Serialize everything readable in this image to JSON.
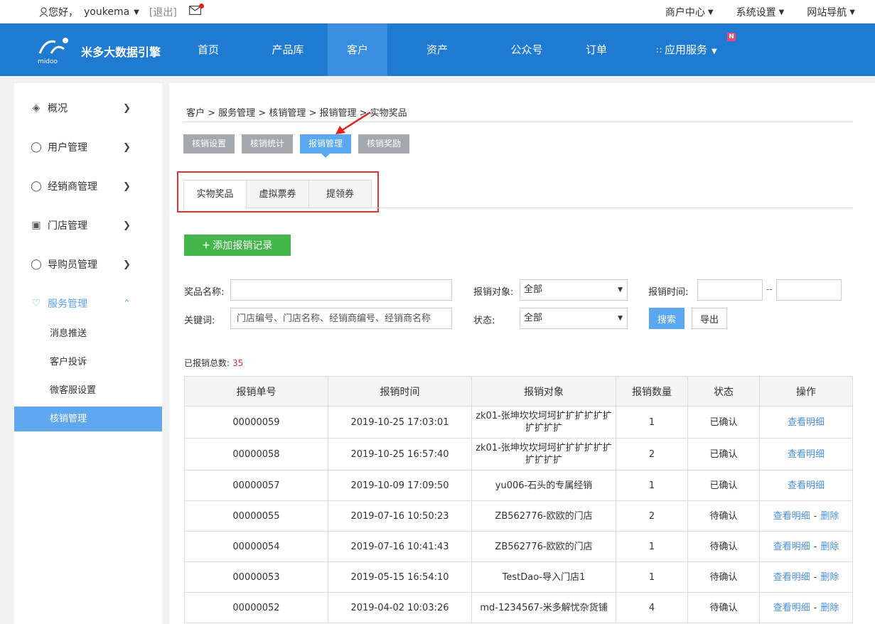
{
  "topbar": {
    "greeting": "您好，",
    "username": "youkema",
    "logout": "[退出]",
    "right_menu": [
      "商户中心",
      "系统设置",
      "网站导航"
    ]
  },
  "header": {
    "brand": "米多大数据引擎",
    "logo_text": "midoo",
    "nav": [
      "首页",
      "产品库",
      "客户",
      "资产",
      "公众号",
      "订单",
      "应用服务"
    ],
    "active_nav": "客户",
    "new_badge": "N"
  },
  "sidebar": {
    "items": [
      {
        "label": "概况",
        "icon": "layers-icon"
      },
      {
        "label": "用户管理",
        "icon": "user-icon"
      },
      {
        "label": "经销商管理",
        "icon": "users-icon"
      },
      {
        "label": "门店管理",
        "icon": "store-icon"
      },
      {
        "label": "导购员管理",
        "icon": "person-icon"
      },
      {
        "label": "服务管理",
        "icon": "heart-icon"
      }
    ],
    "sub_items": [
      "消息推送",
      "客户投诉",
      "微客服设置",
      "核销管理"
    ],
    "active_sub": "核销管理"
  },
  "content": {
    "breadcrumb": "客户 > 服务管理 > 核销管理 > 报销管理 > 实物奖品",
    "subtabs": [
      "核销设置",
      "核销统计",
      "报销管理",
      "核销奖励"
    ],
    "active_subtab": "报销管理",
    "tabs": [
      "实物奖品",
      "虚拟票券",
      "提领券"
    ],
    "active_tab": "实物奖品",
    "add_button": "添加报销记录",
    "filters": {
      "prize_name_label": "奖品名称:",
      "prize_name_value": "",
      "target_label": "报销对象:",
      "target_value": "全部",
      "time_label": "报销时间:",
      "time_from": "",
      "time_to": "",
      "time_separator": "--",
      "keyword_label": "关键词:",
      "keyword_placeholder": "门店编号、门店名称、经销商编号、经销商名称",
      "status_label": "状态:",
      "status_value": "全部",
      "search_button": "搜索",
      "export_button": "导出"
    },
    "total_label": "已报销总数:",
    "total_value": "35",
    "table": {
      "headers": [
        "报销单号",
        "报销时间",
        "报销对象",
        "报销数量",
        "状态",
        "操作"
      ],
      "rows": [
        {
          "id": "00000059",
          "time": "2019-10-25 17:03:01",
          "target": "zk01-张坤坎坎坷坷扩扩扩扩扩扩扩扩扩扩",
          "qty": "1",
          "status": "已确认",
          "view": "查看明细",
          "delete": ""
        },
        {
          "id": "00000058",
          "time": "2019-10-25 16:57:40",
          "target": "zk01-张坤坎坎坷坷扩扩扩扩扩扩扩扩扩扩",
          "qty": "2",
          "status": "已确认",
          "view": "查看明细",
          "delete": ""
        },
        {
          "id": "00000057",
          "time": "2019-10-09 17:09:50",
          "target": "yu006-石头的专属经销",
          "qty": "1",
          "status": "已确认",
          "view": "查看明细",
          "delete": ""
        },
        {
          "id": "00000055",
          "time": "2019-07-16 10:50:23",
          "target": "ZB562776-欧欧的门店",
          "qty": "2",
          "status": "待确认",
          "view": "查看明细",
          "delete": "删除"
        },
        {
          "id": "00000054",
          "time": "2019-07-16 10:41:43",
          "target": "ZB562776-欧欧的门店",
          "qty": "1",
          "status": "待确认",
          "view": "查看明细",
          "delete": "删除"
        },
        {
          "id": "00000053",
          "time": "2019-05-15 16:54:10",
          "target": "TestDao-导入门店1",
          "qty": "1",
          "status": "待确认",
          "view": "查看明细",
          "delete": "删除"
        },
        {
          "id": "00000052",
          "time": "2019-04-02 10:03:26",
          "target": "md-1234567-米多解忧杂货铺",
          "qty": "4",
          "status": "待确认",
          "view": "查看明细",
          "delete": "删除"
        }
      ]
    }
  },
  "colors": {
    "header_bg": "#1e7bd1",
    "accent": "#5aa7f2",
    "add_green": "#44b549",
    "highlight_red": "#e53333"
  }
}
